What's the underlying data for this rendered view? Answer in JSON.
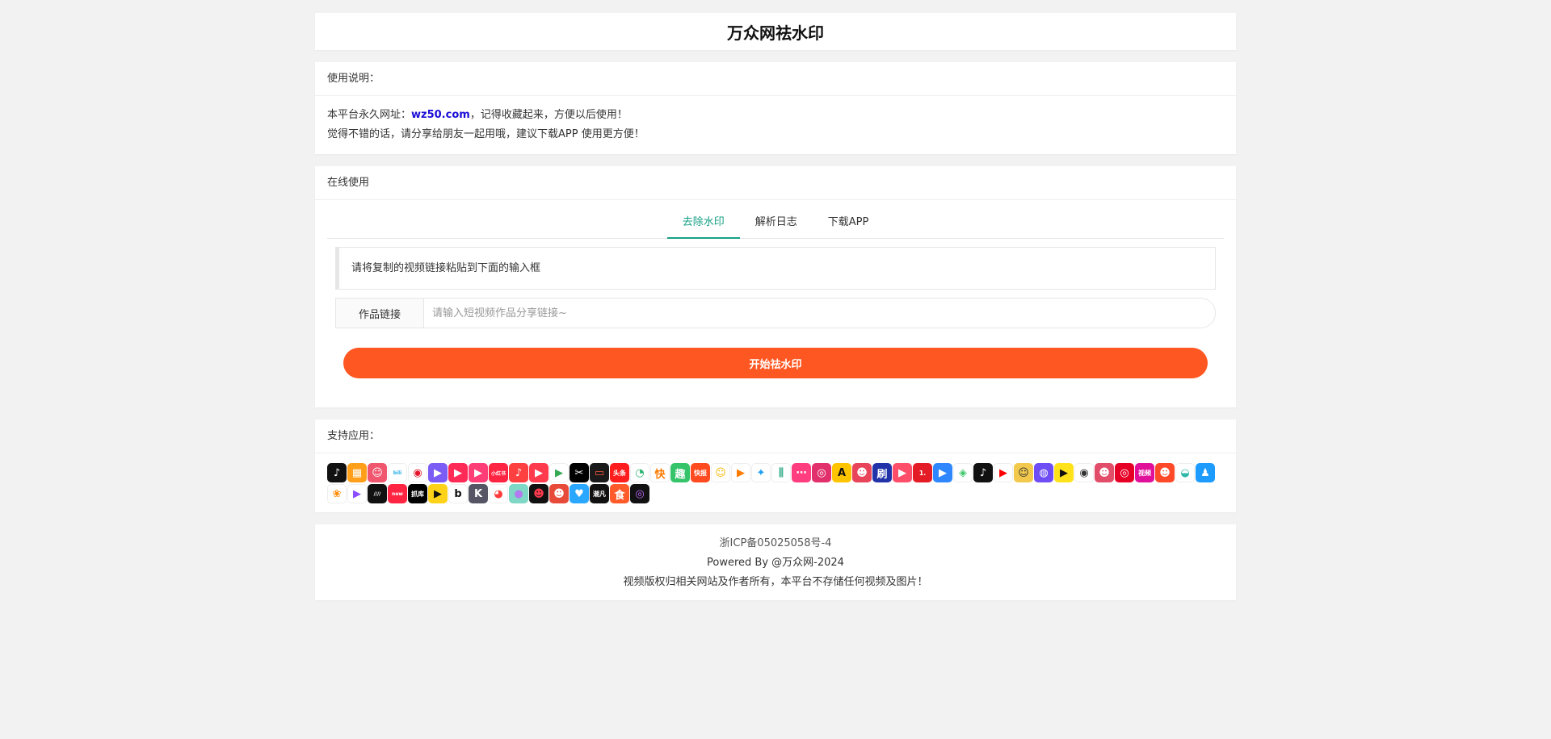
{
  "site": {
    "title": "万众网祛水印"
  },
  "notice": {
    "header": "使用说明：",
    "line1_prefix": "本平台永久网址：",
    "line1_link": "wz50.com",
    "line1_suffix": "，记得收藏起来，方便以后使用！",
    "line2": "觉得不错的话，请分享给朋友一起用哦，建议下载APP 使用更方便！"
  },
  "online": {
    "header": "在线使用",
    "tabs": [
      {
        "label": "去除水印",
        "active": true
      },
      {
        "label": "解析日志",
        "active": false
      },
      {
        "label": "下载APP",
        "active": false
      }
    ],
    "tip": "请将复制的视频链接粘贴到下面的输入框",
    "input_label": "作品链接",
    "input_placeholder": "请输入短视频作品分享链接~",
    "input_value": "",
    "submit_label": "开始祛水印"
  },
  "apps": {
    "header": "支持应用：",
    "icons": [
      {
        "name": "douyin-icon",
        "color": "#111111",
        "glyph": "♪"
      },
      {
        "name": "app-orange-icon",
        "color": "#ff9f1a",
        "glyph": "▦"
      },
      {
        "name": "app-pink-face-icon",
        "color": "#f0566e",
        "glyph": "☺"
      },
      {
        "name": "bilibili-icon",
        "color": "#ffffff",
        "glyph": "bili",
        "fg": "#23ade5"
      },
      {
        "name": "weibo-icon",
        "color": "#ffffff",
        "glyph": "◉",
        "fg": "#e6162d"
      },
      {
        "name": "app-purple-play-icon",
        "color": "#7b5cf5",
        "glyph": "▶"
      },
      {
        "name": "app-red-play-icon",
        "color": "#ff2a55",
        "glyph": "▶"
      },
      {
        "name": "app-pink-play-icon",
        "color": "#ff3d77",
        "glyph": "▶"
      },
      {
        "name": "xiaohongshu-icon",
        "color": "#ff2442",
        "glyph": "小红书"
      },
      {
        "name": "app-redorange-icon",
        "color": "#ff4040",
        "glyph": "♪"
      },
      {
        "name": "app-camera-icon",
        "color": "#ff3a4d",
        "glyph": "▶"
      },
      {
        "name": "google-play-icon",
        "color": "#ffffff",
        "glyph": "▶",
        "fg": "#34a853"
      },
      {
        "name": "capcut-icon",
        "color": "#000000",
        "glyph": "✂"
      },
      {
        "name": "app-black-tv-icon",
        "color": "#1a1a1a",
        "glyph": "▭",
        "fg": "#ff5a3c"
      },
      {
        "name": "app-red-text-icon",
        "color": "#ff1d1d",
        "glyph": "头条"
      },
      {
        "name": "app-chat-icon",
        "color": "#ffffff",
        "glyph": "◔",
        "fg": "#2bb673"
      },
      {
        "name": "kuaishou-icon",
        "color": "#ffffff",
        "glyph": "快",
        "fg": "#ff7a00"
      },
      {
        "name": "app-green-box-icon",
        "color": "#35c46a",
        "glyph": "趣"
      },
      {
        "name": "kuaishou-red-icon",
        "color": "#ff4b1f",
        "glyph": "快报"
      },
      {
        "name": "app-yellow-face-icon",
        "color": "#ffffff",
        "glyph": "☺",
        "fg": "#f5b800"
      },
      {
        "name": "app-orange-arrow-icon",
        "color": "#ffffff",
        "glyph": "▶",
        "fg": "#ff7a00"
      },
      {
        "name": "twitter-icon",
        "color": "#ffffff",
        "glyph": "✦",
        "fg": "#1da1f2"
      },
      {
        "name": "app-bars-icon",
        "color": "#ffffff",
        "glyph": "⫼",
        "fg": "#3bb08f"
      },
      {
        "name": "app-pink-dots-icon",
        "color": "#ff3d7f",
        "glyph": "⋯"
      },
      {
        "name": "instagram-icon",
        "color": "#e1306c",
        "glyph": "◎"
      },
      {
        "name": "app-yellow-a-icon",
        "color": "#ffc400",
        "glyph": "A",
        "fg": "#111111"
      },
      {
        "name": "app-face-icon",
        "color": "#e8445a",
        "glyph": "☻"
      },
      {
        "name": "app-blue-shua-icon",
        "color": "#2233aa",
        "glyph": "刷"
      },
      {
        "name": "app-red-tv-icon",
        "color": "#ff4e6a",
        "glyph": "▶"
      },
      {
        "name": "app-one-icon",
        "color": "#e31c25",
        "glyph": "1."
      },
      {
        "name": "app-blue-play-icon",
        "color": "#2e87ff",
        "glyph": "▶"
      },
      {
        "name": "app-green-eye-icon",
        "color": "#ffffff",
        "glyph": "◈",
        "fg": "#3cc76a"
      },
      {
        "name": "tiktok-icon",
        "color": "#111111",
        "glyph": "♪"
      },
      {
        "name": "youtube-icon",
        "color": "#ffffff",
        "glyph": "▶",
        "fg": "#ff0000"
      },
      {
        "name": "app-cartoon-icon",
        "color": "#f2c94c",
        "glyph": "☺",
        "fg": "#333333"
      },
      {
        "name": "app-purple-chat-icon",
        "color": "#6f4df5",
        "glyph": "◍"
      },
      {
        "name": "app-yellow-drop-icon",
        "color": "#ffe21a",
        "glyph": "▶",
        "fg": "#111111"
      },
      {
        "name": "app-eye-icon",
        "color": "#ffffff",
        "glyph": "◉",
        "fg": "#333333"
      },
      {
        "name": "app-portrait-icon",
        "color": "#e24d6a",
        "glyph": "☻"
      },
      {
        "name": "netease-music-icon",
        "color": "#e60026",
        "glyph": "◎"
      },
      {
        "name": "app-magenta-text-icon",
        "color": "#e0109b",
        "glyph": "视频"
      },
      {
        "name": "app-tiger-icon",
        "color": "#ff4a2a",
        "glyph": "☻"
      },
      {
        "name": "app-bowl-icon",
        "color": "#ffffff",
        "glyph": "◒",
        "fg": "#2cb7a8"
      },
      {
        "name": "qq-icon",
        "color": "#1e9bff",
        "glyph": "♟"
      },
      {
        "name": "app-squirrel-icon",
        "color": "#ffffff",
        "glyph": "❀",
        "fg": "#ff8a00"
      },
      {
        "name": "app-purple-triangle-icon",
        "color": "#ffffff",
        "glyph": "▶",
        "fg": "#8a4dff"
      },
      {
        "name": "app-lines-icon",
        "color": "#111111",
        "glyph": "////"
      },
      {
        "name": "app-red-new-icon",
        "color": "#ff2442",
        "glyph": "new"
      },
      {
        "name": "app-black-text-icon",
        "color": "#000000",
        "glyph": "抓库"
      },
      {
        "name": "app-yellow-circle-icon",
        "color": "#ffd21a",
        "glyph": "▶",
        "fg": "#111111"
      },
      {
        "name": "app-b-icon",
        "color": "#ffffff",
        "glyph": "b",
        "fg": "#111111"
      },
      {
        "name": "app-k-icon",
        "color": "#555566",
        "glyph": "K"
      },
      {
        "name": "app-red-bird-icon",
        "color": "#ffffff",
        "glyph": "◕",
        "fg": "#ff3a3a"
      },
      {
        "name": "app-gradient-ball-icon",
        "color": "#7fd8c6",
        "glyph": "●",
        "fg": "#b27bf0"
      },
      {
        "name": "app-black-face-icon",
        "color": "#111111",
        "glyph": "☻",
        "fg": "#ff3a4d"
      },
      {
        "name": "app-monkey-icon",
        "color": "#e84a3a",
        "glyph": "☻"
      },
      {
        "name": "app-blue-heart-icon",
        "color": "#2aa8ff",
        "glyph": "♥"
      },
      {
        "name": "app-dark-text-icon",
        "color": "#111111",
        "glyph": "潮凡"
      },
      {
        "name": "app-food-icon",
        "color": "#ff5a2a",
        "glyph": "食"
      },
      {
        "name": "app-black-circle-icon",
        "color": "#111111",
        "glyph": "◎",
        "fg": "#c06bff"
      }
    ]
  },
  "footer": {
    "icp": "浙ICP备05025058号-4",
    "powered": "Powered By @万众网-2024",
    "disclaimer": "视频版权归相关网站及作者所有，本平台不存储任何视频及图片！"
  }
}
